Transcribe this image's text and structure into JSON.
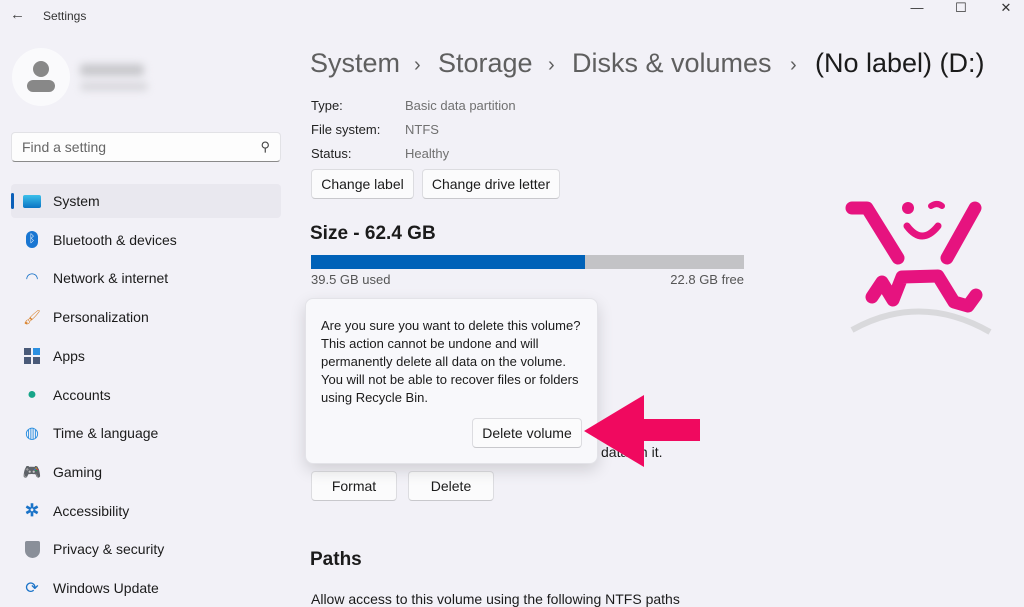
{
  "window": {
    "title": "Settings",
    "minimize": "—",
    "maximize": "☐",
    "close": "✕"
  },
  "search": {
    "placeholder": "Find a setting"
  },
  "sidebar": {
    "items": [
      {
        "label": "System",
        "icon": "system-icon",
        "active": true
      },
      {
        "label": "Bluetooth & devices",
        "icon": "bluetooth-icon"
      },
      {
        "label": "Network & internet",
        "icon": "wifi-icon"
      },
      {
        "label": "Personalization",
        "icon": "brush-icon"
      },
      {
        "label": "Apps",
        "icon": "apps-icon"
      },
      {
        "label": "Accounts",
        "icon": "account-icon"
      },
      {
        "label": "Time & language",
        "icon": "globe-clock-icon"
      },
      {
        "label": "Gaming",
        "icon": "gamepad-icon"
      },
      {
        "label": "Accessibility",
        "icon": "accessibility-icon"
      },
      {
        "label": "Privacy & security",
        "icon": "shield-icon"
      },
      {
        "label": "Windows Update",
        "icon": "update-icon"
      }
    ]
  },
  "breadcrumb": [
    "System",
    "Storage",
    "Disks & volumes",
    "(No label) (D:)"
  ],
  "properties": [
    {
      "label": "Type:",
      "value": "Basic data partition"
    },
    {
      "label": "File system:",
      "value": "NTFS"
    },
    {
      "label": "Status:",
      "value": "Healthy"
    }
  ],
  "buttons": {
    "change_label": "Change label",
    "change_drive_letter": "Change drive letter",
    "format": "Format",
    "delete": "Delete"
  },
  "size": {
    "title": "Size - 62.4 GB",
    "used": "39.5 GB used",
    "free": "22.8 GB free",
    "used_fraction": 0.633
  },
  "hidden_text": "data on it.",
  "flyout": {
    "message": "Are you sure you want to delete this volume? This action cannot be undone and will permanently delete all data on the volume. You will not be able to recover files or folders using Recycle Bin.",
    "confirm": "Delete volume"
  },
  "paths": {
    "title": "Paths",
    "description": "Allow access to this volume using the following NTFS paths"
  },
  "colors": {
    "accent": "#0062b8",
    "annotation": "#f0095f",
    "logo": "#e6137f"
  }
}
